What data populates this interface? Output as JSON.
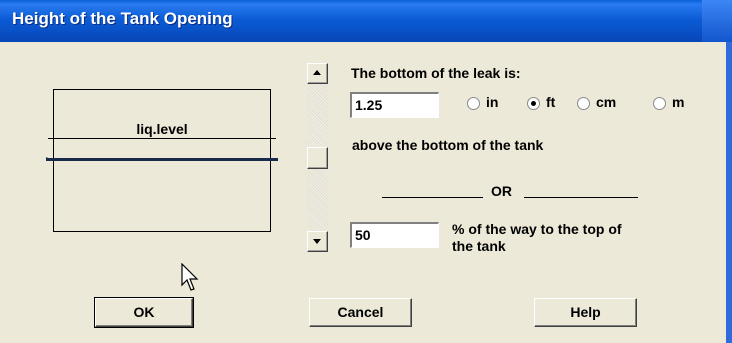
{
  "window": {
    "title": "Height of the Tank Opening"
  },
  "diagram": {
    "liquid_level_label": "liq.level"
  },
  "leak": {
    "prompt": "The bottom of the leak is:",
    "height_value": "1.25",
    "units": [
      "in",
      "ft",
      "cm",
      "m"
    ],
    "selected_unit": "ft",
    "suffix": "above the bottom of the tank",
    "or_label": "OR",
    "percent_value": "50",
    "percent_text_1": "% of the way to the top of",
    "percent_text_2": "the tank"
  },
  "buttons": {
    "ok": "OK",
    "cancel": "Cancel",
    "help": "Help"
  },
  "icons": {
    "scroll_up": "arrow-up-icon",
    "scroll_down": "arrow-down-icon",
    "cursor": "mouse-pointer-icon"
  }
}
